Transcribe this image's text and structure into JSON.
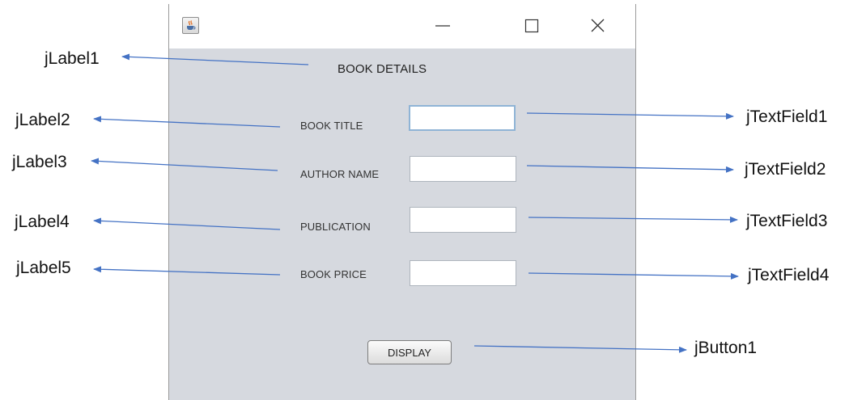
{
  "window": {
    "title_text": "",
    "heading": "BOOK DETAILS",
    "icons": {
      "app": "java-cup-icon",
      "minimize": "minimize-icon",
      "maximize": "maximize-icon",
      "close": "close-icon"
    }
  },
  "form": {
    "fields": [
      {
        "label": "BOOK TITLE",
        "value": ""
      },
      {
        "label": "AUTHOR NAME",
        "value": ""
      },
      {
        "label": "PUBLICATION",
        "value": ""
      },
      {
        "label": "BOOK PRICE",
        "value": ""
      }
    ],
    "button_label": "DISPLAY"
  },
  "annotations": {
    "labels": [
      "jLabel1",
      "jLabel2",
      "jLabel3",
      "jLabel4",
      "jLabel5"
    ],
    "text_fields": [
      "jTextField1",
      "jTextField2",
      "jTextField3",
      "jTextField4"
    ],
    "button": "jButton1",
    "arrow_color": "#4472c4"
  }
}
